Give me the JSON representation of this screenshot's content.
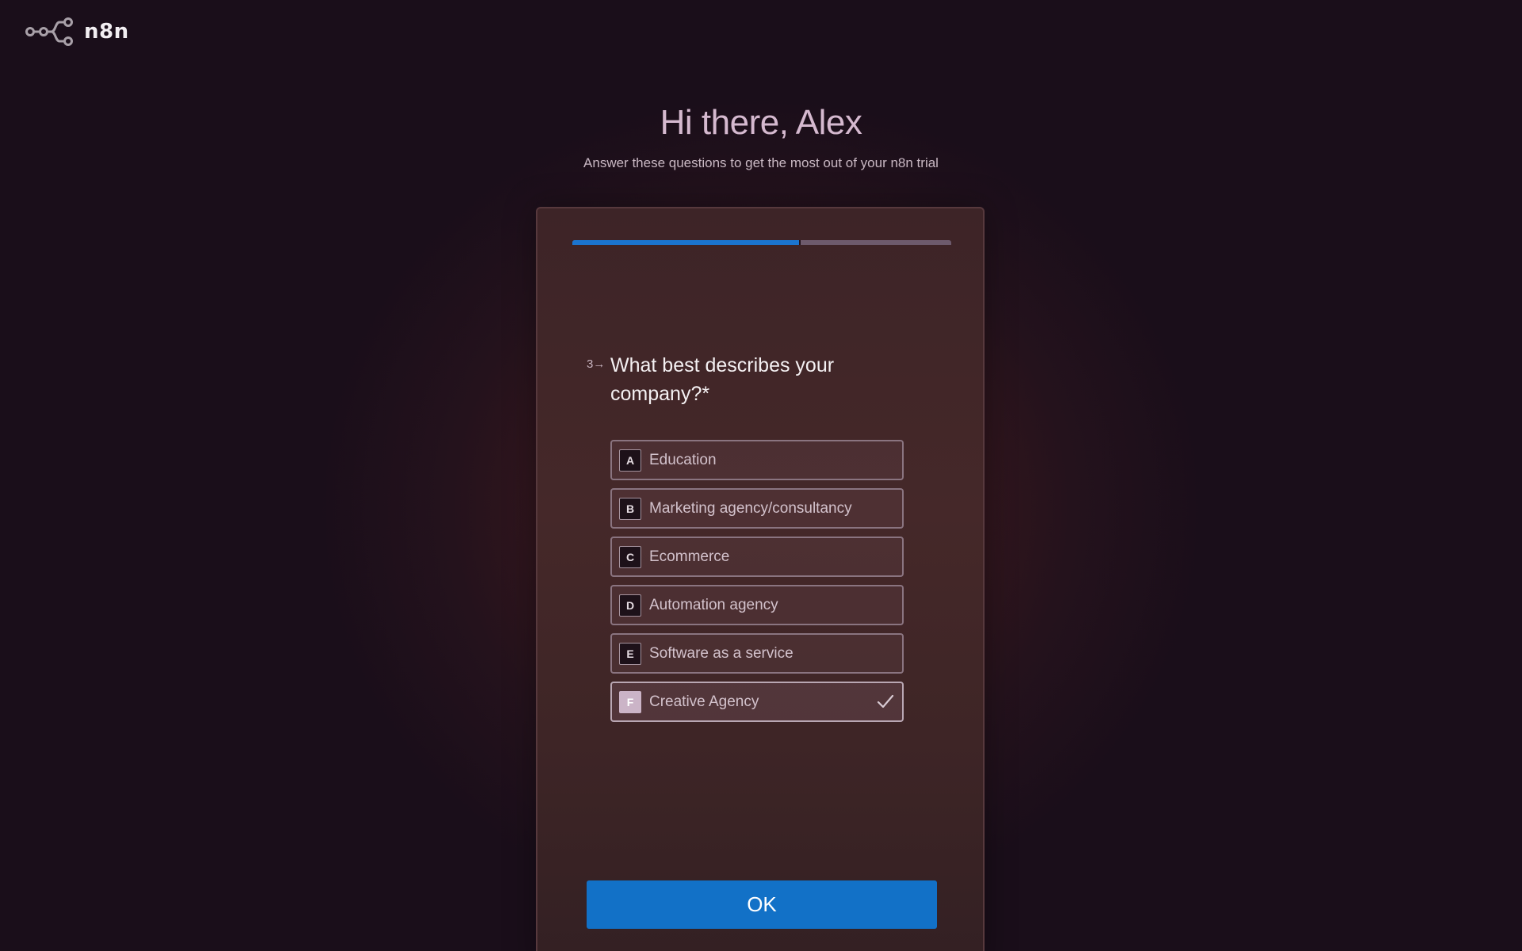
{
  "brand": {
    "name": "n8n",
    "logo_icon": "n8n-logo-icon"
  },
  "header": {
    "greeting": "Hi there, Alex",
    "subtitle": "Answer these questions to get the most out of your n8n trial"
  },
  "survey": {
    "progress_fraction": 0.6,
    "question_number": "3→",
    "question_text": "What best describes your company?*",
    "options": [
      {
        "key": "A",
        "label": "Education",
        "selected": false
      },
      {
        "key": "B",
        "label": "Marketing agency/consultancy",
        "selected": false
      },
      {
        "key": "C",
        "label": "Ecommerce",
        "selected": false
      },
      {
        "key": "D",
        "label": "Automation agency",
        "selected": false
      },
      {
        "key": "E",
        "label": "Software as a service",
        "selected": false
      },
      {
        "key": "F",
        "label": "Creative Agency",
        "selected": true
      }
    ],
    "ok_label": "OK"
  },
  "colors": {
    "accent": "#1271c7",
    "background": "#1a0e1a",
    "card": "#452829"
  }
}
